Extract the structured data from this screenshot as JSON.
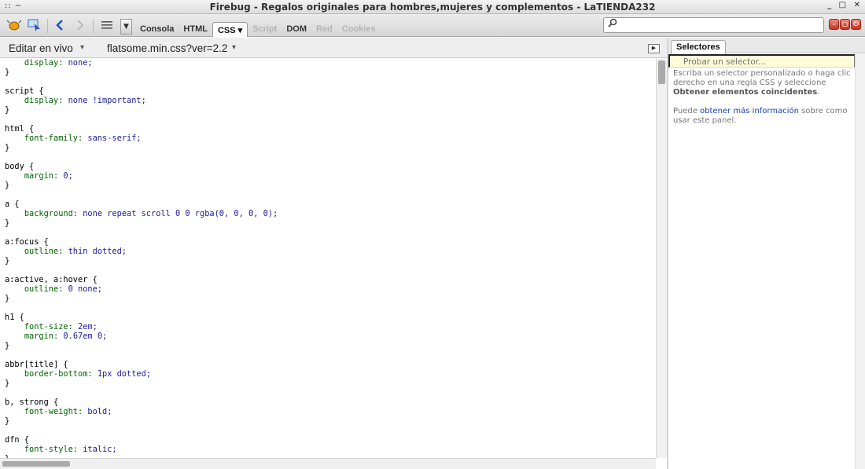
{
  "window": {
    "menu_glyph": ":: −",
    "title": "Firebug - Regalos originales para hombres,mujeres y complementos - LaTIENDA232",
    "controls": [
      "_",
      "□",
      "✕"
    ]
  },
  "toolbar": {
    "tabs": [
      {
        "label": "Consola",
        "state": "normal"
      },
      {
        "label": "HTML",
        "state": "normal"
      },
      {
        "label": "CSS ▾",
        "state": "active"
      },
      {
        "label": "Script",
        "state": "disabled"
      },
      {
        "label": "DOM",
        "state": "normal"
      },
      {
        "label": "Red",
        "state": "disabled"
      },
      {
        "label": "Cookies",
        "state": "disabled"
      }
    ],
    "search_value": "",
    "icons": [
      "firebug-icon",
      "inspect-icon",
      "back-arrow-icon",
      "forward-arrow-icon",
      "menu-lines-icon",
      "chevron-down-icon",
      "search-icon"
    ]
  },
  "subbar": {
    "edit_live": "Editar en vivo",
    "file": "flatsome.min.css?ver=2.2",
    "dropdown_glyph": "▾"
  },
  "css_rules": [
    {
      "selector": null,
      "decls": [
        [
          "display",
          "none;"
        ]
      ]
    },
    {
      "selector": "script",
      "decls": [
        [
          "display",
          "none !important;"
        ]
      ]
    },
    {
      "selector": "html",
      "decls": [
        [
          "font-family",
          "sans-serif;"
        ]
      ]
    },
    {
      "selector": "body",
      "decls": [
        [
          "margin",
          "0;"
        ]
      ]
    },
    {
      "selector": "a",
      "decls": [
        [
          "background",
          "none repeat scroll 0 0 rgba(0, 0, 0, 0);"
        ]
      ]
    },
    {
      "selector": "a:focus",
      "decls": [
        [
          "outline",
          "thin dotted;"
        ]
      ]
    },
    {
      "selector": "a:active, a:hover",
      "decls": [
        [
          "outline",
          "0 none;"
        ]
      ]
    },
    {
      "selector": "h1",
      "decls": [
        [
          "font-size",
          "2em;"
        ],
        [
          "margin",
          "0.67em 0;"
        ]
      ]
    },
    {
      "selector": "abbr[title]",
      "decls": [
        [
          "border-bottom",
          "1px dotted;"
        ]
      ]
    },
    {
      "selector": "b, strong",
      "decls": [
        [
          "font-weight",
          "bold;"
        ]
      ]
    },
    {
      "selector": "dfn",
      "decls": [
        [
          "font-style",
          "italic;"
        ]
      ]
    }
  ],
  "side_panel": {
    "tab": "Selectores",
    "input_placeholder": "Probar un selector...",
    "help_1_start": "Escriba un selector personalizado o haga clic derecho en una regla CSS y seleccione ",
    "help_1_bold": "Obtener elementos coincidentes",
    "help_1_end": ".",
    "help_2_start": "Puede ",
    "help_2_link": "obtener más información",
    "help_2_end": " sobre como usar este panel."
  }
}
